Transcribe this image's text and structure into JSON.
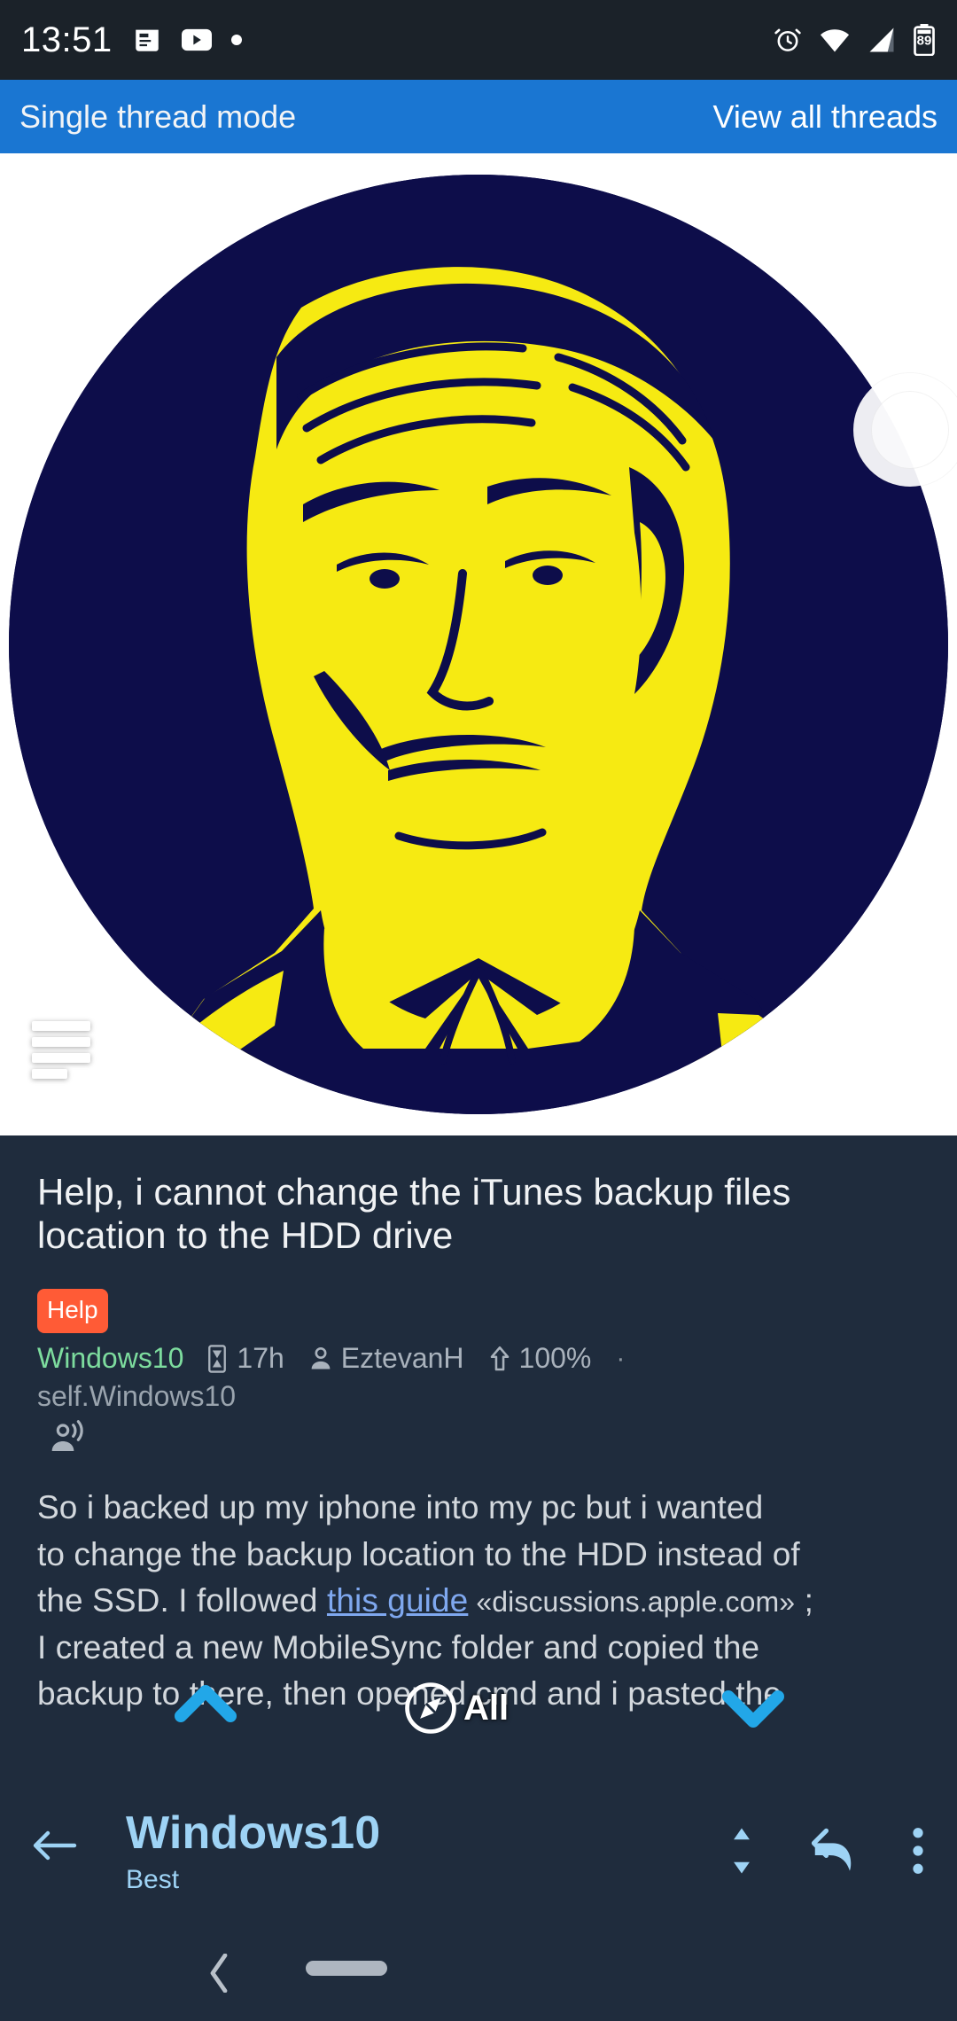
{
  "status_bar": {
    "time": "13:51",
    "left_icons": [
      "news-icon",
      "youtube-icon",
      "dot-icon"
    ],
    "right_icons": [
      "alarm-icon",
      "wifi-icon",
      "signal-icon",
      "battery-icon"
    ],
    "battery_level": "89",
    "background": "#1b2229"
  },
  "banner": {
    "left_label": "Single thread mode",
    "right_label": "View all threads",
    "background": "#1a76d2"
  },
  "hero": {
    "image_alt": "Alan Turing stencil portrait, yellow on dark navy",
    "image_colors": {
      "background": "#0d0d4a",
      "figure": "#f6ea12",
      "page": "#ffffff"
    },
    "text_icon_name": "article-text-icon",
    "circle_button_name": "image-action-circle-button"
  },
  "post": {
    "title": "Help, i cannot change the iTunes backup files location to the HDD drive",
    "flair": "Help",
    "flair_color": "#ff5b36",
    "subreddit": "Windows10",
    "subreddit_color": "#7ddc9e",
    "age": "17h",
    "author": "EztevanH",
    "upvote_ratio": "100%",
    "separator_dot": "·",
    "self_source": "self.Windows10",
    "body_line_1": "So i backed up my iphone into my pc but i wanted",
    "body_line_2": "to change the backup location to the HDD instead of",
    "body_line_3a": "the SSD. I followed ",
    "body_link": "this guide",
    "body_host": "«discussions.apple.com»",
    "body_line_3c": " ;",
    "body_line_4": "I created a new MobileSync folder and copied the",
    "body_line_5": "backup to there, then opened cmd and i pasted the",
    "link_color": "#7fa8ef"
  },
  "float_nav": {
    "up_icon": "chevron-up-icon",
    "down_icon": "chevron-down-icon",
    "compass_icon": "compass-navigate-icon",
    "compass_label": "All",
    "accent_color": "#22a7e8"
  },
  "bottom_bar": {
    "back_icon": "arrow-left-icon",
    "title": "Windows10",
    "subtitle": "Best",
    "sort_icon": "sort-updown-icon",
    "reply_icon": "reply-arrow-icon",
    "overflow_icon": "more-vertical-icon",
    "accent_color": "#9ed3f5"
  },
  "android_nav": {
    "back_icon": "nav-back-chevron-icon",
    "home_pill": "nav-home-pill"
  }
}
